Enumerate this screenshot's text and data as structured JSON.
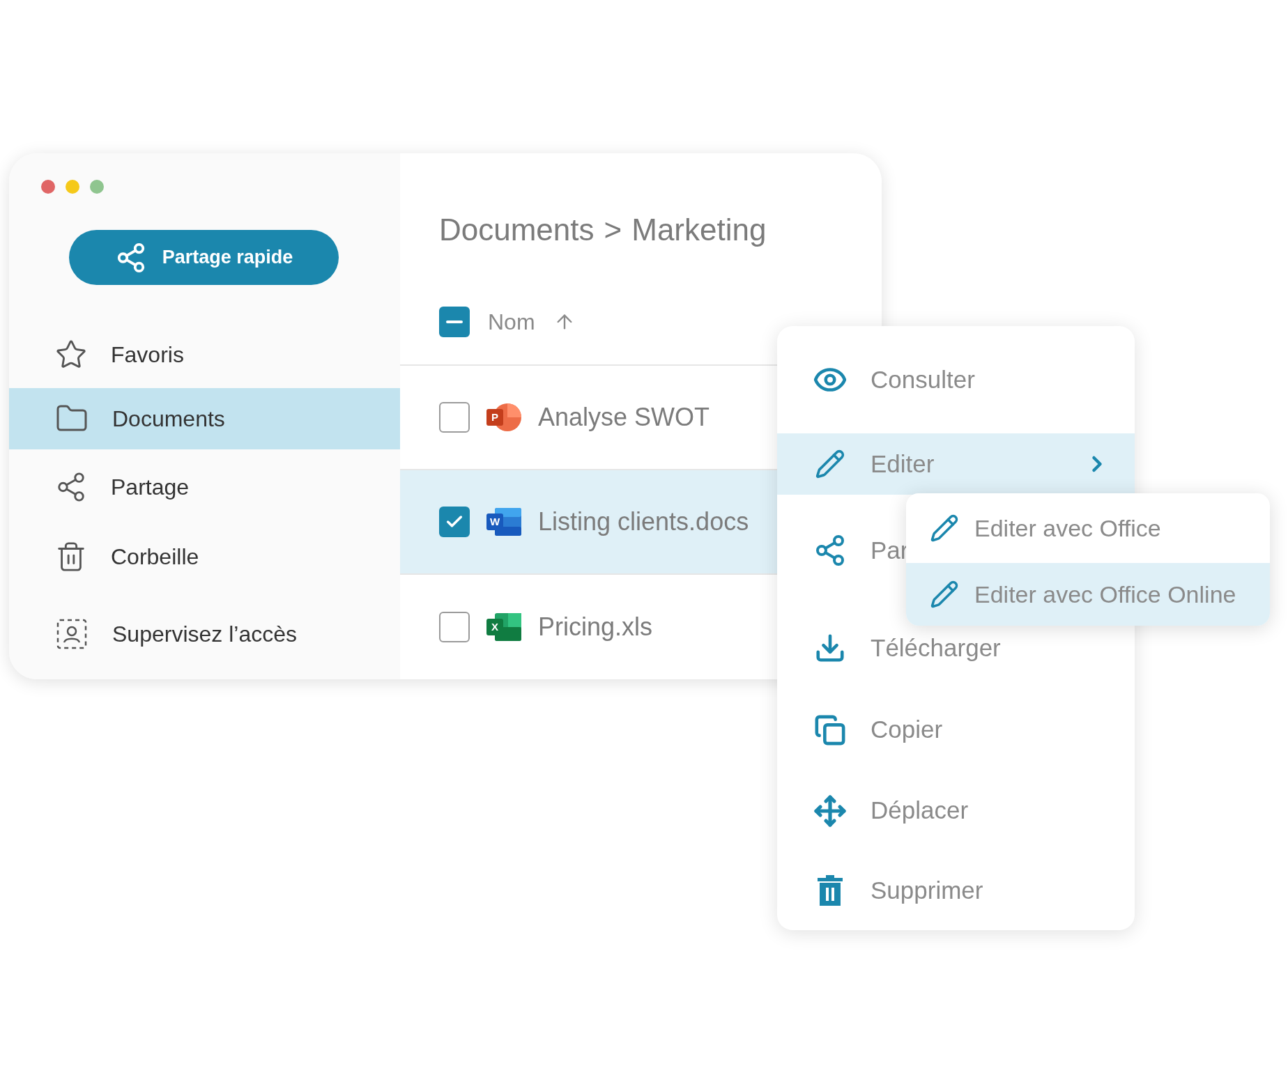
{
  "sidebar": {
    "quick_share": {
      "label": "Partage rapide"
    },
    "items": [
      {
        "label": "Favoris",
        "selected": false
      },
      {
        "label": "Documents",
        "selected": true
      },
      {
        "label": "Partage",
        "selected": false
      },
      {
        "label": "Corbeille",
        "selected": false
      },
      {
        "label": "Supervisez l’accès",
        "selected": false
      }
    ]
  },
  "breadcrumb": {
    "items": [
      "Documents",
      "Marketing"
    ],
    "separator": ">"
  },
  "table": {
    "select_all": {
      "indeterminate": true
    },
    "column": {
      "label": "Nom",
      "sort_ascending": true
    },
    "rows": [
      {
        "name": "Analyse SWOT",
        "kind": "powerpoint",
        "badge": "P",
        "checked": false,
        "selected": false
      },
      {
        "name": "Listing clients.docs",
        "kind": "word",
        "badge": "W",
        "checked": true,
        "selected": true
      },
      {
        "name": "Pricing.xls",
        "kind": "excel",
        "badge": "X",
        "checked": false,
        "selected": false
      }
    ]
  },
  "context_menu": {
    "items": [
      {
        "label": "Consulter",
        "selected": false,
        "submenu": false
      },
      {
        "label": "Editer",
        "selected": true,
        "submenu": true
      },
      {
        "label": "Par",
        "selected": false,
        "submenu": false
      },
      {
        "label": "Télécharger",
        "selected": false,
        "submenu": false
      },
      {
        "label": "Copier",
        "selected": false,
        "submenu": false
      },
      {
        "label": "Déplacer",
        "selected": false,
        "submenu": false
      },
      {
        "label": "Supprimer",
        "selected": false,
        "submenu": false
      }
    ]
  },
  "submenu": {
    "items": [
      {
        "label": "Editer avec Office",
        "selected": false
      },
      {
        "label": "Editer avec Office Online",
        "selected": true
      }
    ]
  }
}
